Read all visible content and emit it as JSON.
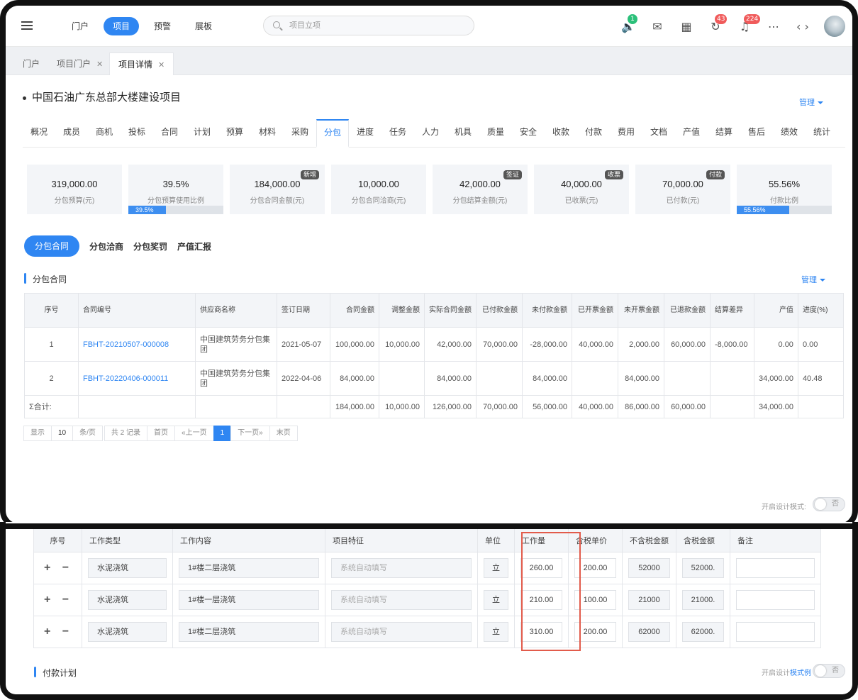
{
  "header": {
    "nav": [
      "门户",
      "项目",
      "预警",
      "展板"
    ],
    "active_nav": "项目",
    "search_placeholder": "项目立项",
    "badges": {
      "speaker": "1",
      "sync": "43",
      "bell": "224"
    }
  },
  "tabs": [
    {
      "label": "门户",
      "closable": false
    },
    {
      "label": "项目门户",
      "closable": true
    },
    {
      "label": "项目详情",
      "closable": true
    }
  ],
  "project": {
    "title": "中国石油广东总部大楼建设项目",
    "manage": "管理"
  },
  "modules": [
    "概况",
    "成员",
    "商机",
    "投标",
    "合同",
    "计划",
    "预算",
    "材料",
    "采购",
    "分包",
    "进度",
    "任务",
    "人力",
    "机具",
    "质量",
    "安全",
    "收款",
    "付款",
    "费用",
    "文档",
    "产值",
    "结算",
    "售后",
    "绩效",
    "统计"
  ],
  "active_module": "分包",
  "cards": [
    {
      "value": "319,000.00",
      "label": "分包预算(元)"
    },
    {
      "value": "39.5%",
      "label": "分包预算使用比例",
      "progress": 39.5,
      "bar_text": "39.5%"
    },
    {
      "value": "184,000.00",
      "label": "分包合同金额(元)",
      "tag": "新增"
    },
    {
      "value": "10,000.00",
      "label": "分包合同洽商(元)"
    },
    {
      "value": "42,000.00",
      "label": "分包结算金额(元)",
      "tag": "签证"
    },
    {
      "value": "40,000.00",
      "label": "已收票(元)",
      "tag": "收票"
    },
    {
      "value": "70,000.00",
      "label": "已付款(元)",
      "tag": "付款"
    },
    {
      "value": "55.56%",
      "label": "付款比例",
      "progress": 55.56,
      "bar_text": "55.56%"
    }
  ],
  "subtabs": [
    "分包合同",
    "分包洽商",
    "分包奖罚",
    "产值汇报"
  ],
  "contracts": {
    "section_title": "分包合同",
    "manage": "管理",
    "columns": [
      "序号",
      "合同编号",
      "供应商名称",
      "签订日期",
      "合同金额",
      "调整金额",
      "实际合同金额",
      "已付款金额",
      "未付款金额",
      "已开票金额",
      "未开票金额",
      "已退款金额",
      "结算差异",
      "产值",
      "进度(%)"
    ],
    "rows": [
      [
        "1",
        "FBHT-20210507-000008",
        "中国建筑劳务分包集团",
        "2021-05-07",
        "100,000.00",
        "10,000.00",
        "42,000.00",
        "70,000.00",
        "-28,000.00",
        "40,000.00",
        "2,000.00",
        "60,000.00",
        "-8,000.00",
        "0.00",
        "0.00"
      ],
      [
        "2",
        "FBHT-20220406-000011",
        "中国建筑劳务分包集团",
        "2022-04-06",
        "84,000.00",
        "",
        "84,000.00",
        "",
        "84,000.00",
        "",
        "84,000.00",
        "",
        "",
        "34,000.00",
        "40.48"
      ]
    ],
    "sum": [
      "Σ合计:",
      "",
      "",
      "",
      "184,000.00",
      "10,000.00",
      "126,000.00",
      "70,000.00",
      "56,000.00",
      "40,000.00",
      "86,000.00",
      "60,000.00",
      "",
      "34,000.00",
      ""
    ]
  },
  "pager": {
    "show": "显示",
    "size": "10",
    "per": "条/页",
    "total": "共 2 记录",
    "first": "首页",
    "prev": "«上一页",
    "current": "1",
    "next": "下一页»",
    "last": "末页"
  },
  "design_mode": {
    "label": "开启设计模式:",
    "toggle": "否"
  },
  "work": {
    "columns": [
      "序号",
      "工作类型",
      "工作内容",
      "项目特征",
      "单位",
      "工作量",
      "含税单价",
      "不含税金额",
      "含税金额",
      "备注"
    ],
    "rows": [
      {
        "type": "水泥浇筑",
        "content": "1#楼二层浇筑",
        "feature": "系统自动填写",
        "unit": "立",
        "qty": "260.00",
        "price": "200.00",
        "net": "52000",
        "gross": "52000."
      },
      {
        "type": "水泥浇筑",
        "content": "1#楼一层浇筑",
        "feature": "系统自动填写",
        "unit": "立",
        "qty": "210.00",
        "price": "100.00",
        "net": "21000",
        "gross": "21000."
      },
      {
        "type": "水泥浇筑",
        "content": "1#楼二层浇筑",
        "feature": "系统自动填写",
        "unit": "立",
        "qty": "310.00",
        "price": "200.00",
        "net": "62000",
        "gross": "62000."
      }
    ],
    "pm": "+ −"
  },
  "payment": {
    "section_title": "付款计划",
    "design_label": "开启设计",
    "link": "模式例",
    "toggle": "否"
  }
}
